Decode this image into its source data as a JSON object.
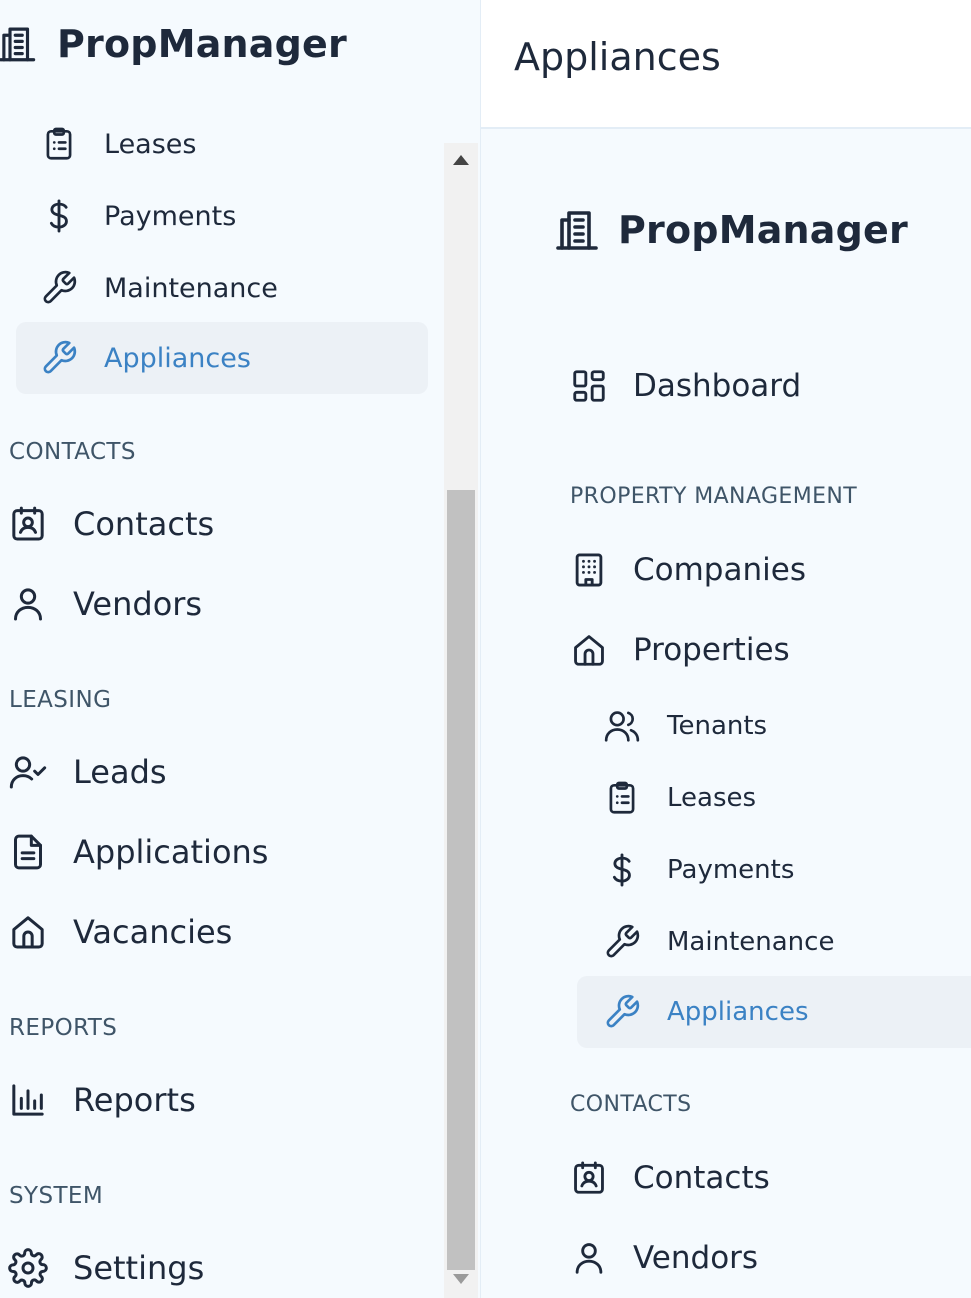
{
  "app": {
    "brand": "PropManager"
  },
  "header": {
    "title": "Appliances"
  },
  "colors": {
    "active": "#3b82c4",
    "active_bg": "#ecf1f6",
    "text": "#1e293b",
    "section": "#3f5568",
    "sidebar_bg": "#f5fafe"
  },
  "left_sidebar": {
    "sub_items": [
      {
        "label": "Leases",
        "icon": "clipboard-list-icon"
      },
      {
        "label": "Payments",
        "icon": "dollar-icon"
      },
      {
        "label": "Maintenance",
        "icon": "wrench-icon"
      },
      {
        "label": "Appliances",
        "icon": "wrench-icon",
        "active": true
      }
    ],
    "sections": [
      {
        "heading": "CONTACTS",
        "items": [
          {
            "label": "Contacts",
            "icon": "contact-card-icon"
          },
          {
            "label": "Vendors",
            "icon": "user-icon"
          }
        ]
      },
      {
        "heading": "LEASING",
        "items": [
          {
            "label": "Leads",
            "icon": "user-check-icon"
          },
          {
            "label": "Applications",
            "icon": "document-icon"
          },
          {
            "label": "Vacancies",
            "icon": "home-icon"
          }
        ]
      },
      {
        "heading": "REPORTS",
        "items": [
          {
            "label": "Reports",
            "icon": "bar-chart-icon"
          }
        ]
      },
      {
        "heading": "SYSTEM",
        "items": [
          {
            "label": "Settings",
            "icon": "gear-icon"
          }
        ]
      }
    ]
  },
  "right_sidebar": {
    "dashboard": {
      "label": "Dashboard",
      "icon": "dashboard-icon"
    },
    "sections": [
      {
        "heading": "PROPERTY MANAGEMENT",
        "items": [
          {
            "label": "Companies",
            "icon": "building-icon"
          },
          {
            "label": "Properties",
            "icon": "home-icon"
          }
        ],
        "sub_items": [
          {
            "label": "Tenants",
            "icon": "users-icon"
          },
          {
            "label": "Leases",
            "icon": "clipboard-list-icon"
          },
          {
            "label": "Payments",
            "icon": "dollar-icon"
          },
          {
            "label": "Maintenance",
            "icon": "wrench-icon"
          },
          {
            "label": "Appliances",
            "icon": "wrench-icon",
            "active": true
          }
        ]
      },
      {
        "heading": "CONTACTS",
        "items": [
          {
            "label": "Contacts",
            "icon": "contact-card-icon"
          },
          {
            "label": "Vendors",
            "icon": "user-icon"
          }
        ]
      }
    ]
  }
}
